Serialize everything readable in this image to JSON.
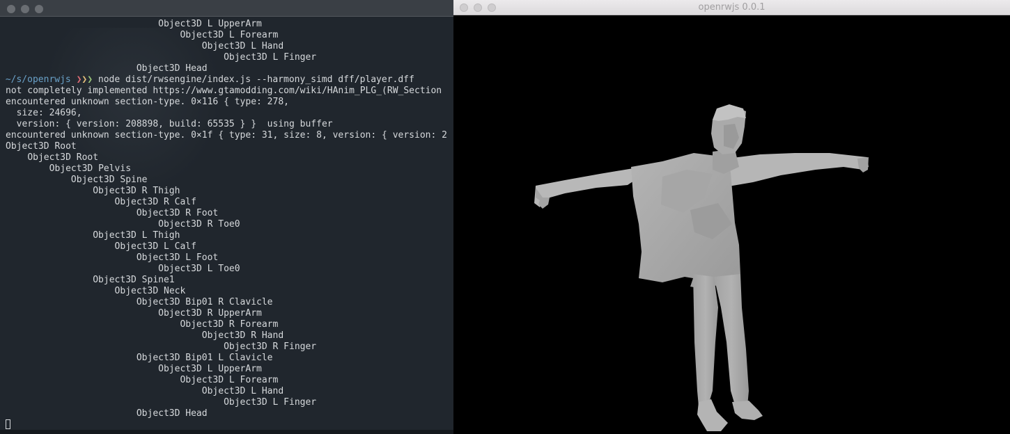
{
  "terminal": {
    "lines_top": [
      {
        "indent": 28,
        "text": "Object3D L UpperArm"
      },
      {
        "indent": 32,
        "text": "Object3D L Forearm"
      },
      {
        "indent": 36,
        "text": "Object3D L Hand"
      },
      {
        "indent": 40,
        "text": "Object3D L Finger"
      },
      {
        "indent": 24,
        "text": "Object3D Head"
      }
    ],
    "prompt": {
      "caret": "▸",
      "path": "~/s/openrwjs",
      "chevrons": "❯❯❯",
      "command": "node dist/rwsengine/index.js --harmony_simd dff/player.dff"
    },
    "output": [
      {
        "indent": 0,
        "text": "not completely implemented https://www.gtamodding.com/wiki/HAnim_PLG_(RW_Section"
      },
      {
        "indent": 0,
        "text": "encountered unknown section-type. 0×116 { type: 278,"
      },
      {
        "indent": 2,
        "text": "size: 24696,"
      },
      {
        "indent": 2,
        "text": "version: { version: 208898, build: 65535 } }  using buffer"
      },
      {
        "indent": 0,
        "text": "encountered unknown section-type. 0×1f { type: 31, size: 8, version: { version: 2"
      },
      {
        "indent": 0,
        "text": "Object3D Root"
      },
      {
        "indent": 4,
        "text": "Object3D Root"
      },
      {
        "indent": 8,
        "text": "Object3D Pelvis"
      },
      {
        "indent": 12,
        "text": "Object3D Spine"
      },
      {
        "indent": 16,
        "text": "Object3D R Thigh"
      },
      {
        "indent": 20,
        "text": "Object3D R Calf"
      },
      {
        "indent": 24,
        "text": "Object3D R Foot"
      },
      {
        "indent": 28,
        "text": "Object3D R Toe0"
      },
      {
        "indent": 16,
        "text": "Object3D L Thigh"
      },
      {
        "indent": 20,
        "text": "Object3D L Calf"
      },
      {
        "indent": 24,
        "text": "Object3D L Foot"
      },
      {
        "indent": 28,
        "text": "Object3D L Toe0"
      },
      {
        "indent": 16,
        "text": "Object3D Spine1"
      },
      {
        "indent": 20,
        "text": "Object3D Neck"
      },
      {
        "indent": 24,
        "text": "Object3D Bip01 R Clavicle"
      },
      {
        "indent": 28,
        "text": "Object3D R UpperArm"
      },
      {
        "indent": 32,
        "text": "Object3D R Forearm"
      },
      {
        "indent": 36,
        "text": "Object3D R Hand"
      },
      {
        "indent": 40,
        "text": "Object3D R Finger"
      },
      {
        "indent": 24,
        "text": "Object3D Bip01 L Clavicle"
      },
      {
        "indent": 28,
        "text": "Object3D L UpperArm"
      },
      {
        "indent": 32,
        "text": "Object3D L Forearm"
      },
      {
        "indent": 36,
        "text": "Object3D L Hand"
      },
      {
        "indent": 40,
        "text": "Object3D L Finger"
      },
      {
        "indent": 24,
        "text": "Object3D Head"
      }
    ],
    "colors": {
      "background": "#20262d",
      "text": "#d6d9dc",
      "prompt_path": "#6aa2c9",
      "chevron_red": "#e06c75",
      "chevron_yellow": "#e5c07b",
      "chevron_green": "#98c379"
    }
  },
  "viewer": {
    "title": "openrwjs 0.0.1",
    "model_color": "#a8a8a8",
    "background": "#000000"
  }
}
